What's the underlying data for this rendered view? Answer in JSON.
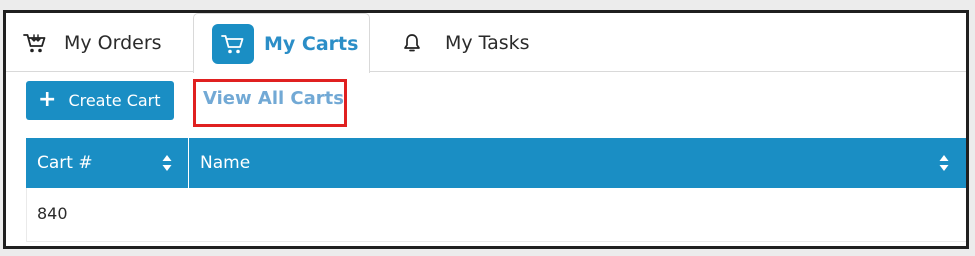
{
  "tabs": [
    {
      "label": "My Orders",
      "icon": "cart-icon",
      "active": false
    },
    {
      "label": "My Carts",
      "icon": "shopping-cart-icon",
      "active": true
    },
    {
      "label": "My Tasks",
      "icon": "bell-icon",
      "active": false
    }
  ],
  "actions": {
    "create_cart_label": "Create Cart",
    "view_all_carts_label": "View All Carts"
  },
  "table": {
    "columns": [
      "Cart #",
      "Name"
    ],
    "rows": [
      {
        "cart_number": "840",
        "name": ""
      }
    ]
  },
  "colors": {
    "accent": "#1a8ec4",
    "active_tab_text": "#2b8ec7",
    "link": "#72a9d5",
    "highlight": "#e02020"
  }
}
